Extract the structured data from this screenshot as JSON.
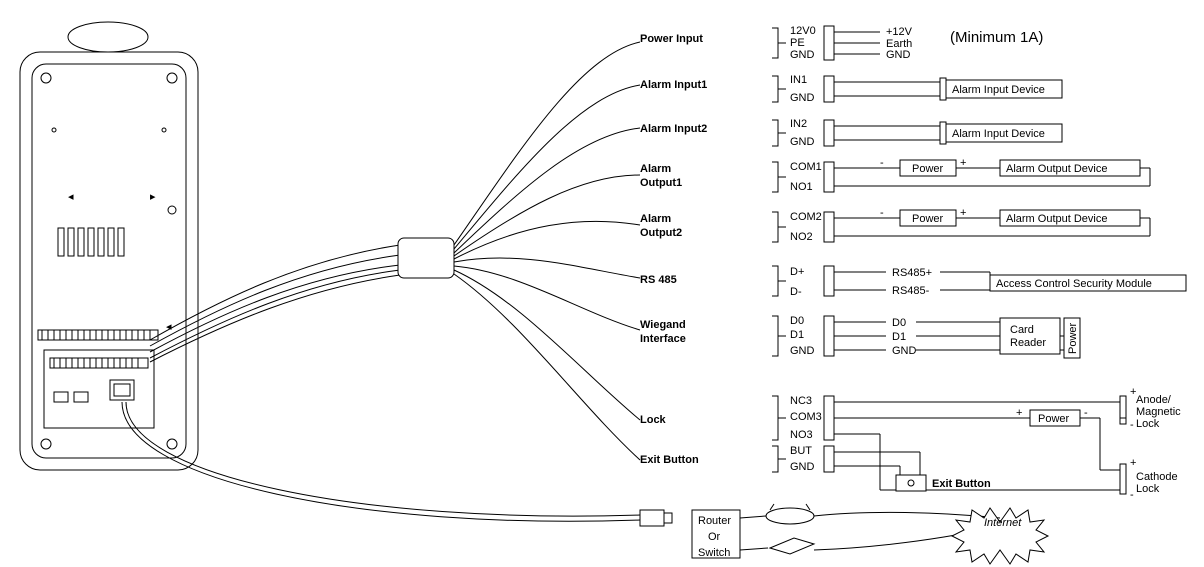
{
  "groups": {
    "power_input": {
      "name": "Power Input",
      "pins": [
        "12V0",
        "PE",
        "GND"
      ],
      "signals": [
        "+12V",
        "Earth",
        "GND"
      ],
      "note": "(Minimum 1A)"
    },
    "alarm_in1": {
      "name": "Alarm Input1",
      "pins": [
        "IN1",
        "GND"
      ],
      "device": "Alarm Input Device"
    },
    "alarm_in2": {
      "name": "Alarm Input2",
      "pins": [
        "IN2",
        "GND"
      ],
      "device": "Alarm Input Device"
    },
    "alarm_out1": {
      "name": "Alarm\nOutput1",
      "pins": [
        "COM1",
        "NO1"
      ],
      "power": "Power",
      "device": "Alarm Output Device",
      "plus": "+",
      "minus": "-"
    },
    "alarm_out2": {
      "name": "Alarm\nOutput2",
      "pins": [
        "COM2",
        "NO2"
      ],
      "power": "Power",
      "device": "Alarm Output Device",
      "plus": "+",
      "minus": "-"
    },
    "rs485": {
      "name": "RS 485",
      "pins": [
        "D+",
        "D-"
      ],
      "signals": [
        "RS485+",
        "RS485-"
      ],
      "device": "Access Control Security Module"
    },
    "wiegand": {
      "name": "Wiegand\nInterface",
      "pins": [
        "D0",
        "D1",
        "GND"
      ],
      "signals": [
        "D0",
        "D1",
        "GND"
      ],
      "device": "Card\nReader",
      "power": "Power"
    },
    "lock": {
      "name": "Lock",
      "pins": [
        "NC3",
        "COM3",
        "NO3"
      ],
      "power": "Power",
      "plus": "+",
      "minus": "-",
      "anode": "Anode/\nMagnetic\nLock",
      "cathode": "Cathode\nLock"
    },
    "exit": {
      "name": "Exit Button",
      "pins": [
        "BUT",
        "GND"
      ],
      "device": "Exit Button"
    },
    "net": {
      "router": "Router",
      "or": "Or",
      "switch": "Switch",
      "internet": "Internet"
    }
  }
}
